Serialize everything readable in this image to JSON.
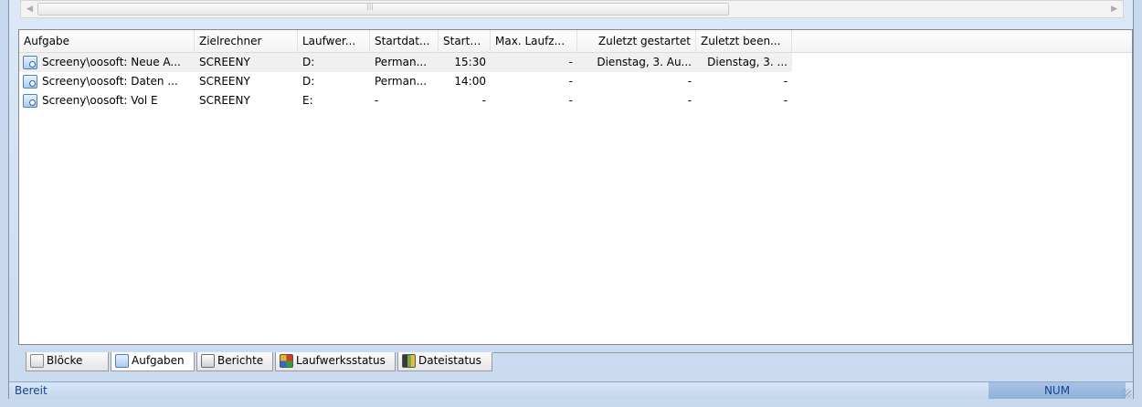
{
  "table": {
    "columns": [
      {
        "label": "Aufgabe",
        "align": "left"
      },
      {
        "label": "Zielrechner",
        "align": "left"
      },
      {
        "label": "Laufwer...",
        "align": "left"
      },
      {
        "label": "Startdat...",
        "align": "left"
      },
      {
        "label": "Startz...",
        "align": "left"
      },
      {
        "label": "Max. Laufz...",
        "align": "left"
      },
      {
        "label": "Zuletzt gestartet",
        "align": "right"
      },
      {
        "label": "Zuletzt been...",
        "align": "left"
      }
    ],
    "rows": [
      {
        "cells": [
          "Screeny\\oosoft: Neue A...",
          "SCREENY",
          "D:",
          "Perman...",
          "15:30",
          "-",
          "Dienstag, 3. Au...",
          "Dienstag, 3. ..."
        ],
        "selected": true
      },
      {
        "cells": [
          "Screeny\\oosoft: Daten ...",
          "SCREENY",
          "D:",
          "Perman...",
          "14:00",
          "-",
          "-",
          "-"
        ],
        "selected": false
      },
      {
        "cells": [
          "Screeny\\oosoft: Vol E",
          "SCREENY",
          "E:",
          "-",
          "-",
          "-",
          "-",
          "-"
        ],
        "selected": false
      }
    ]
  },
  "tabs": [
    {
      "label": "Blöcke",
      "icon": "blocks-icon",
      "active": false
    },
    {
      "label": "Aufgaben",
      "icon": "tasks-icon",
      "active": true
    },
    {
      "label": "Berichte",
      "icon": "reports-icon",
      "active": false
    },
    {
      "label": "Laufwerksstatus",
      "icon": "drive-status-icon",
      "active": false
    },
    {
      "label": "Dateistatus",
      "icon": "file-status-icon",
      "active": false
    }
  ],
  "statusbar": {
    "text": "Bereit",
    "num": "NUM"
  },
  "colors": {
    "accent": "#15428b",
    "frame": "#c9daf0"
  }
}
